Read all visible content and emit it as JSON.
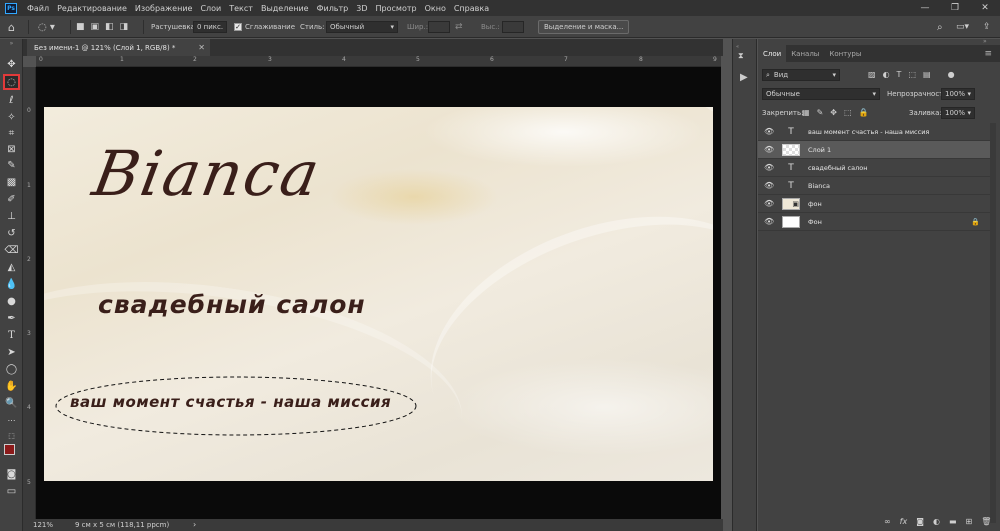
{
  "menubar": {
    "items": [
      "Файл",
      "Редактирование",
      "Изображение",
      "Слои",
      "Текст",
      "Выделение",
      "Фильтр",
      "3D",
      "Просмотр",
      "Окно",
      "Справка"
    ],
    "logo": "Ps"
  },
  "options": {
    "feather_label": "Растушевка:",
    "feather_value": "0 пикс.",
    "antialias_label": "Сглаживание",
    "style_label": "Стиль:",
    "style_value": "Обычный",
    "width_label": "Шир.:",
    "height_label": "Выс.:",
    "mask_button": "Выделение и маска..."
  },
  "document": {
    "tab_title": "Без имени-1 @ 121% (Слой 1, RGB/8) *"
  },
  "rulers": {
    "top": [
      "0",
      "1",
      "2",
      "3",
      "4",
      "5",
      "6",
      "7",
      "8",
      "9"
    ],
    "left": [
      "0",
      "1",
      "2",
      "3",
      "4",
      "5"
    ]
  },
  "artboard": {
    "brand": "Bianca",
    "subtitle": "свадебный салон",
    "tagline": "ваш момент счастья - наша миссия"
  },
  "status": {
    "zoom": "121%",
    "doc_size": "9 см x 5 см (118,11 ppcm)"
  },
  "layers_panel": {
    "tabs": [
      "Слои",
      "Каналы",
      "Контуры"
    ],
    "filter_label": "Вид",
    "blend_mode": "Обычные",
    "opacity_label": "Непрозрачность:",
    "opacity_value": "100%",
    "lock_label": "Закрепить:",
    "fill_label": "Заливка:",
    "fill_value": "100%",
    "layers": [
      {
        "name": "ваш момент счастья - наша миссия",
        "kind": "text"
      },
      {
        "name": "Слой 1",
        "kind": "pixel"
      },
      {
        "name": "свадебный салон",
        "kind": "text"
      },
      {
        "name": "Bianca",
        "kind": "text"
      },
      {
        "name": "фон",
        "kind": "smart"
      },
      {
        "name": "Фон",
        "kind": "background"
      }
    ]
  },
  "colors": {
    "foreground": "#8b1a1a",
    "background": "#b03030",
    "text_brown": "#3a1f1a",
    "accent": "#e23a3a"
  }
}
